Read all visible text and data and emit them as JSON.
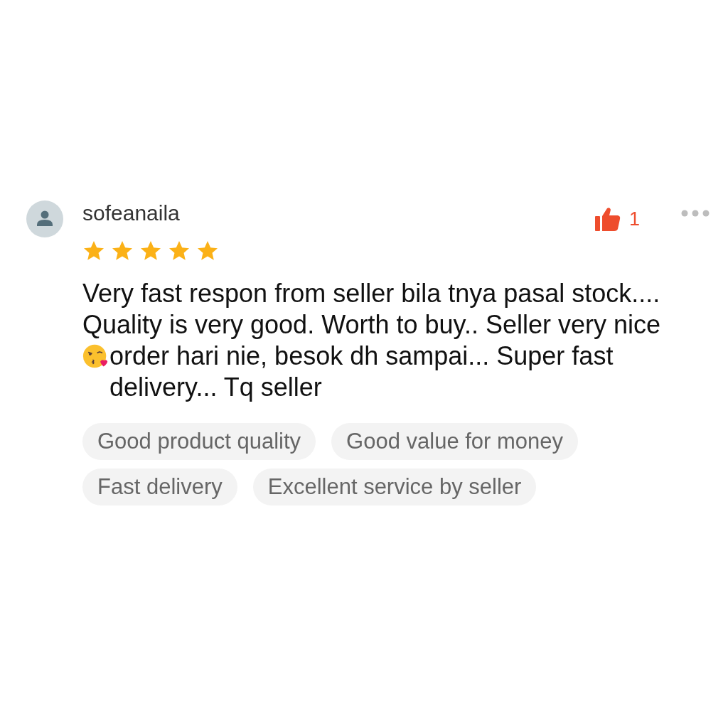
{
  "review": {
    "username": "sofeanaila",
    "stars": 5,
    "liked": true,
    "like_count": "1",
    "text_before": "Very fast respon from seller bila tnya pasal stock.... Quality is very good. Worth to buy.. Seller very nice",
    "text_after": "order hari nie, besok dh sampai... Super fast delivery... Tq seller",
    "tags": [
      "Good product quality",
      "Good value for money",
      "Fast delivery",
      "Excellent service by seller"
    ]
  }
}
